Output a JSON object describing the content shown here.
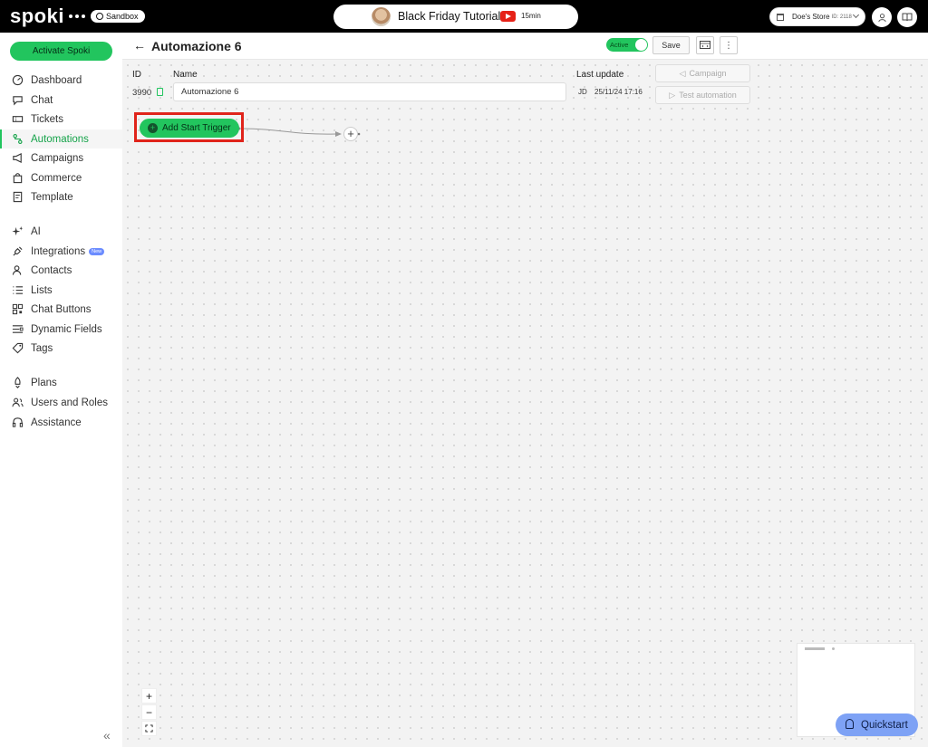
{
  "topbar": {
    "logo": "spoki",
    "sandbox_label": "Sandbox",
    "tutorial_title": "Black Friday Tutorial",
    "tutorial_duration": "15min",
    "store_name": "Doe's Store",
    "store_id": "ID: 2118"
  },
  "sidebar": {
    "activate_label": "Activate Spoki",
    "items": [
      {
        "label": "Dashboard",
        "icon": "gauge-icon"
      },
      {
        "label": "Chat",
        "icon": "chat-bubble-icon"
      },
      {
        "label": "Tickets",
        "icon": "ticket-icon"
      },
      {
        "label": "Automations",
        "icon": "automation-icon",
        "active": true
      },
      {
        "label": "Campaigns",
        "icon": "megaphone-icon"
      },
      {
        "label": "Commerce",
        "icon": "shopping-bag-icon"
      },
      {
        "label": "Template",
        "icon": "template-icon"
      },
      {
        "label": "AI",
        "icon": "sparkle-icon"
      },
      {
        "label": "Integrations",
        "icon": "plug-icon",
        "badge": "New"
      },
      {
        "label": "Contacts",
        "icon": "contacts-icon"
      },
      {
        "label": "Lists",
        "icon": "list-icon"
      },
      {
        "label": "Chat Buttons",
        "icon": "qr-icon"
      },
      {
        "label": "Dynamic Fields",
        "icon": "fields-icon"
      },
      {
        "label": "Tags",
        "icon": "tag-icon"
      },
      {
        "label": "Plans",
        "icon": "rocket-icon"
      },
      {
        "label": "Users and Roles",
        "icon": "users-icon"
      },
      {
        "label": "Assistance",
        "icon": "headset-icon"
      }
    ]
  },
  "header": {
    "title": "Automazione 6",
    "active_label": "Active",
    "save_label": "Save"
  },
  "info": {
    "id_label": "ID",
    "id_value": "3990",
    "name_label": "Name",
    "name_value": "Automazione 6",
    "last_update_label": "Last update",
    "last_update_initials": "JD",
    "last_update_value": "25/11/24 17:16",
    "campaign_label": "Campaign",
    "test_label": "Test automation"
  },
  "canvas": {
    "trigger_label": "Add Start Trigger"
  },
  "quickstart_label": "Quickstart",
  "colors": {
    "accent": "#22c55e",
    "highlight": "#e0241b",
    "quickstart": "#7ea2f5"
  }
}
